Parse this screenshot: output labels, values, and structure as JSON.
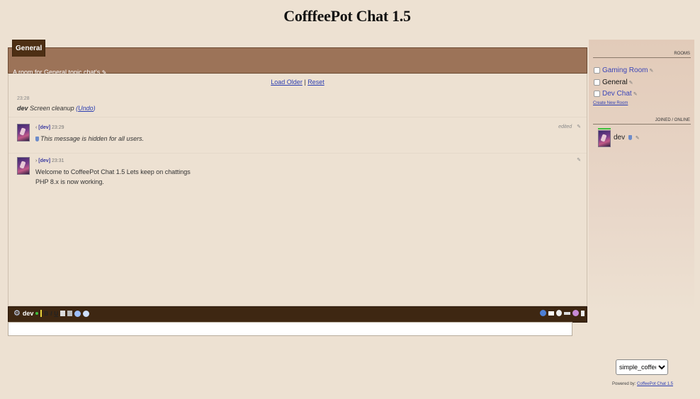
{
  "app_title": "CofffeePot Chat 1.5",
  "room": {
    "tab_label": "General",
    "description": "A room for General topic chat's",
    "description_icon": "edit-icon"
  },
  "messages_area": {
    "load_older": "Load Older",
    "separator": "|",
    "reset": "Reset",
    "system_event": {
      "time": "23:28",
      "user": "dev",
      "text": "Screen cleanup",
      "undo_open": "(",
      "undo_link": "Undo",
      "undo_close": ")"
    },
    "messages": [
      {
        "arrow": "‹",
        "user": "[dev]",
        "time": "23:29",
        "status": "edited",
        "lines": [
          "This message is hidden for all users."
        ],
        "hidden": true
      },
      {
        "arrow": "›",
        "user": "[dev]",
        "time": "23:31",
        "status": "",
        "lines": [
          "Welcome to CoffeePot Chat 1.5 Lets keep on chattings",
          "PHP 8.x is now working."
        ],
        "hidden": false
      }
    ]
  },
  "toolbar": {
    "user": "dev",
    "left_items": [
      "B",
      "I",
      "U"
    ],
    "left_icons": [
      "settings-gear-icon",
      "online-status-icon",
      "bold-icon",
      "italic-icon",
      "underline-icon",
      "paste-icon",
      "clipboard-icon",
      "upload-icon",
      "emoji-icon"
    ],
    "right_icons": [
      "info-icon",
      "message-icon",
      "time-icon",
      "minimize-icon",
      "avatar-icon",
      "sound-icon"
    ]
  },
  "input": {
    "value": "",
    "placeholder": ""
  },
  "sidebar": {
    "rooms_label": "ROOMS",
    "rooms": [
      {
        "name": "Gaming Room",
        "current": false
      },
      {
        "name": "General",
        "current": true
      },
      {
        "name": "Dev Chat",
        "current": false
      }
    ],
    "create_room": "Create New Room",
    "online_label": "JOINED / ONLINE",
    "online_users": [
      {
        "name": "dev"
      }
    ]
  },
  "footer": {
    "skin_selected": "simple_coffee",
    "powered_by_label": "Powered by:",
    "powered_by_link": "CoffeePot Chat 1.5"
  },
  "colors": {
    "background": "#ede1d2",
    "room_header": "#9c7358",
    "tab": "#4d2f14",
    "toolbar": "#3e2712",
    "link": "#2b3db1"
  }
}
